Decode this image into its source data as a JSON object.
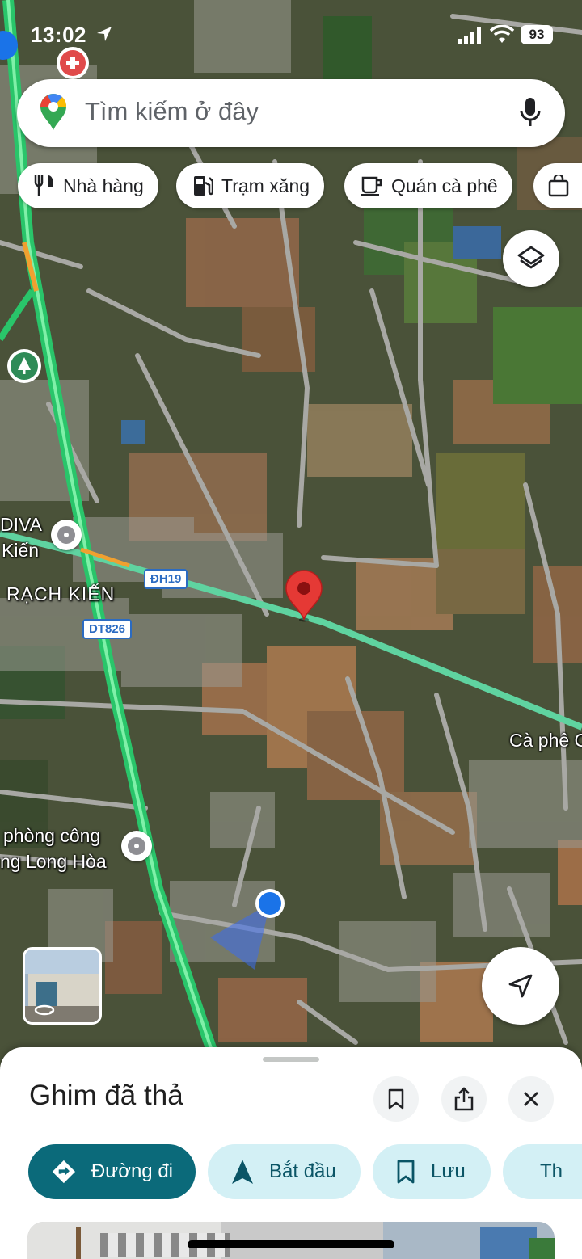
{
  "status_bar": {
    "time": "13:02",
    "battery": "93"
  },
  "search": {
    "placeholder": "Tìm kiếm ở đây"
  },
  "chips": [
    {
      "label": "Nhà hàng",
      "icon": "fork-knife-icon"
    },
    {
      "label": "Trạm xăng",
      "icon": "gas-station-icon"
    },
    {
      "label": "Quán cà phê",
      "icon": "coffee-cup-icon"
    },
    {
      "label": "",
      "icon": "shopping-bag-icon"
    }
  ],
  "map": {
    "labels": {
      "diva": "DIVA",
      "kien": "Kiến",
      "rach_kien": "RẠCH KIẾN",
      "phong_cong": "phòng công",
      "long_hoa": "ng Long Hòa",
      "ca_phe": "Cà phê C"
    },
    "shields": {
      "dh19": "ĐH19",
      "dt826": "DT826"
    }
  },
  "sheet": {
    "title": "Ghim đã thả",
    "actions": [
      {
        "label": "Đường đi",
        "icon": "directions-icon"
      },
      {
        "label": "Bắt đầu",
        "icon": "navigation-arrow-icon"
      },
      {
        "label": "Lưu",
        "icon": "bookmark-icon"
      },
      {
        "label": "Th",
        "icon": "flag-icon"
      }
    ]
  },
  "colors": {
    "accent_primary": "#0b6a7a",
    "accent_secondary_bg": "#d3f0f5",
    "highway": "#3ccc7a",
    "dropped_pin": "#e53935",
    "location_dot": "#1a73e8"
  }
}
